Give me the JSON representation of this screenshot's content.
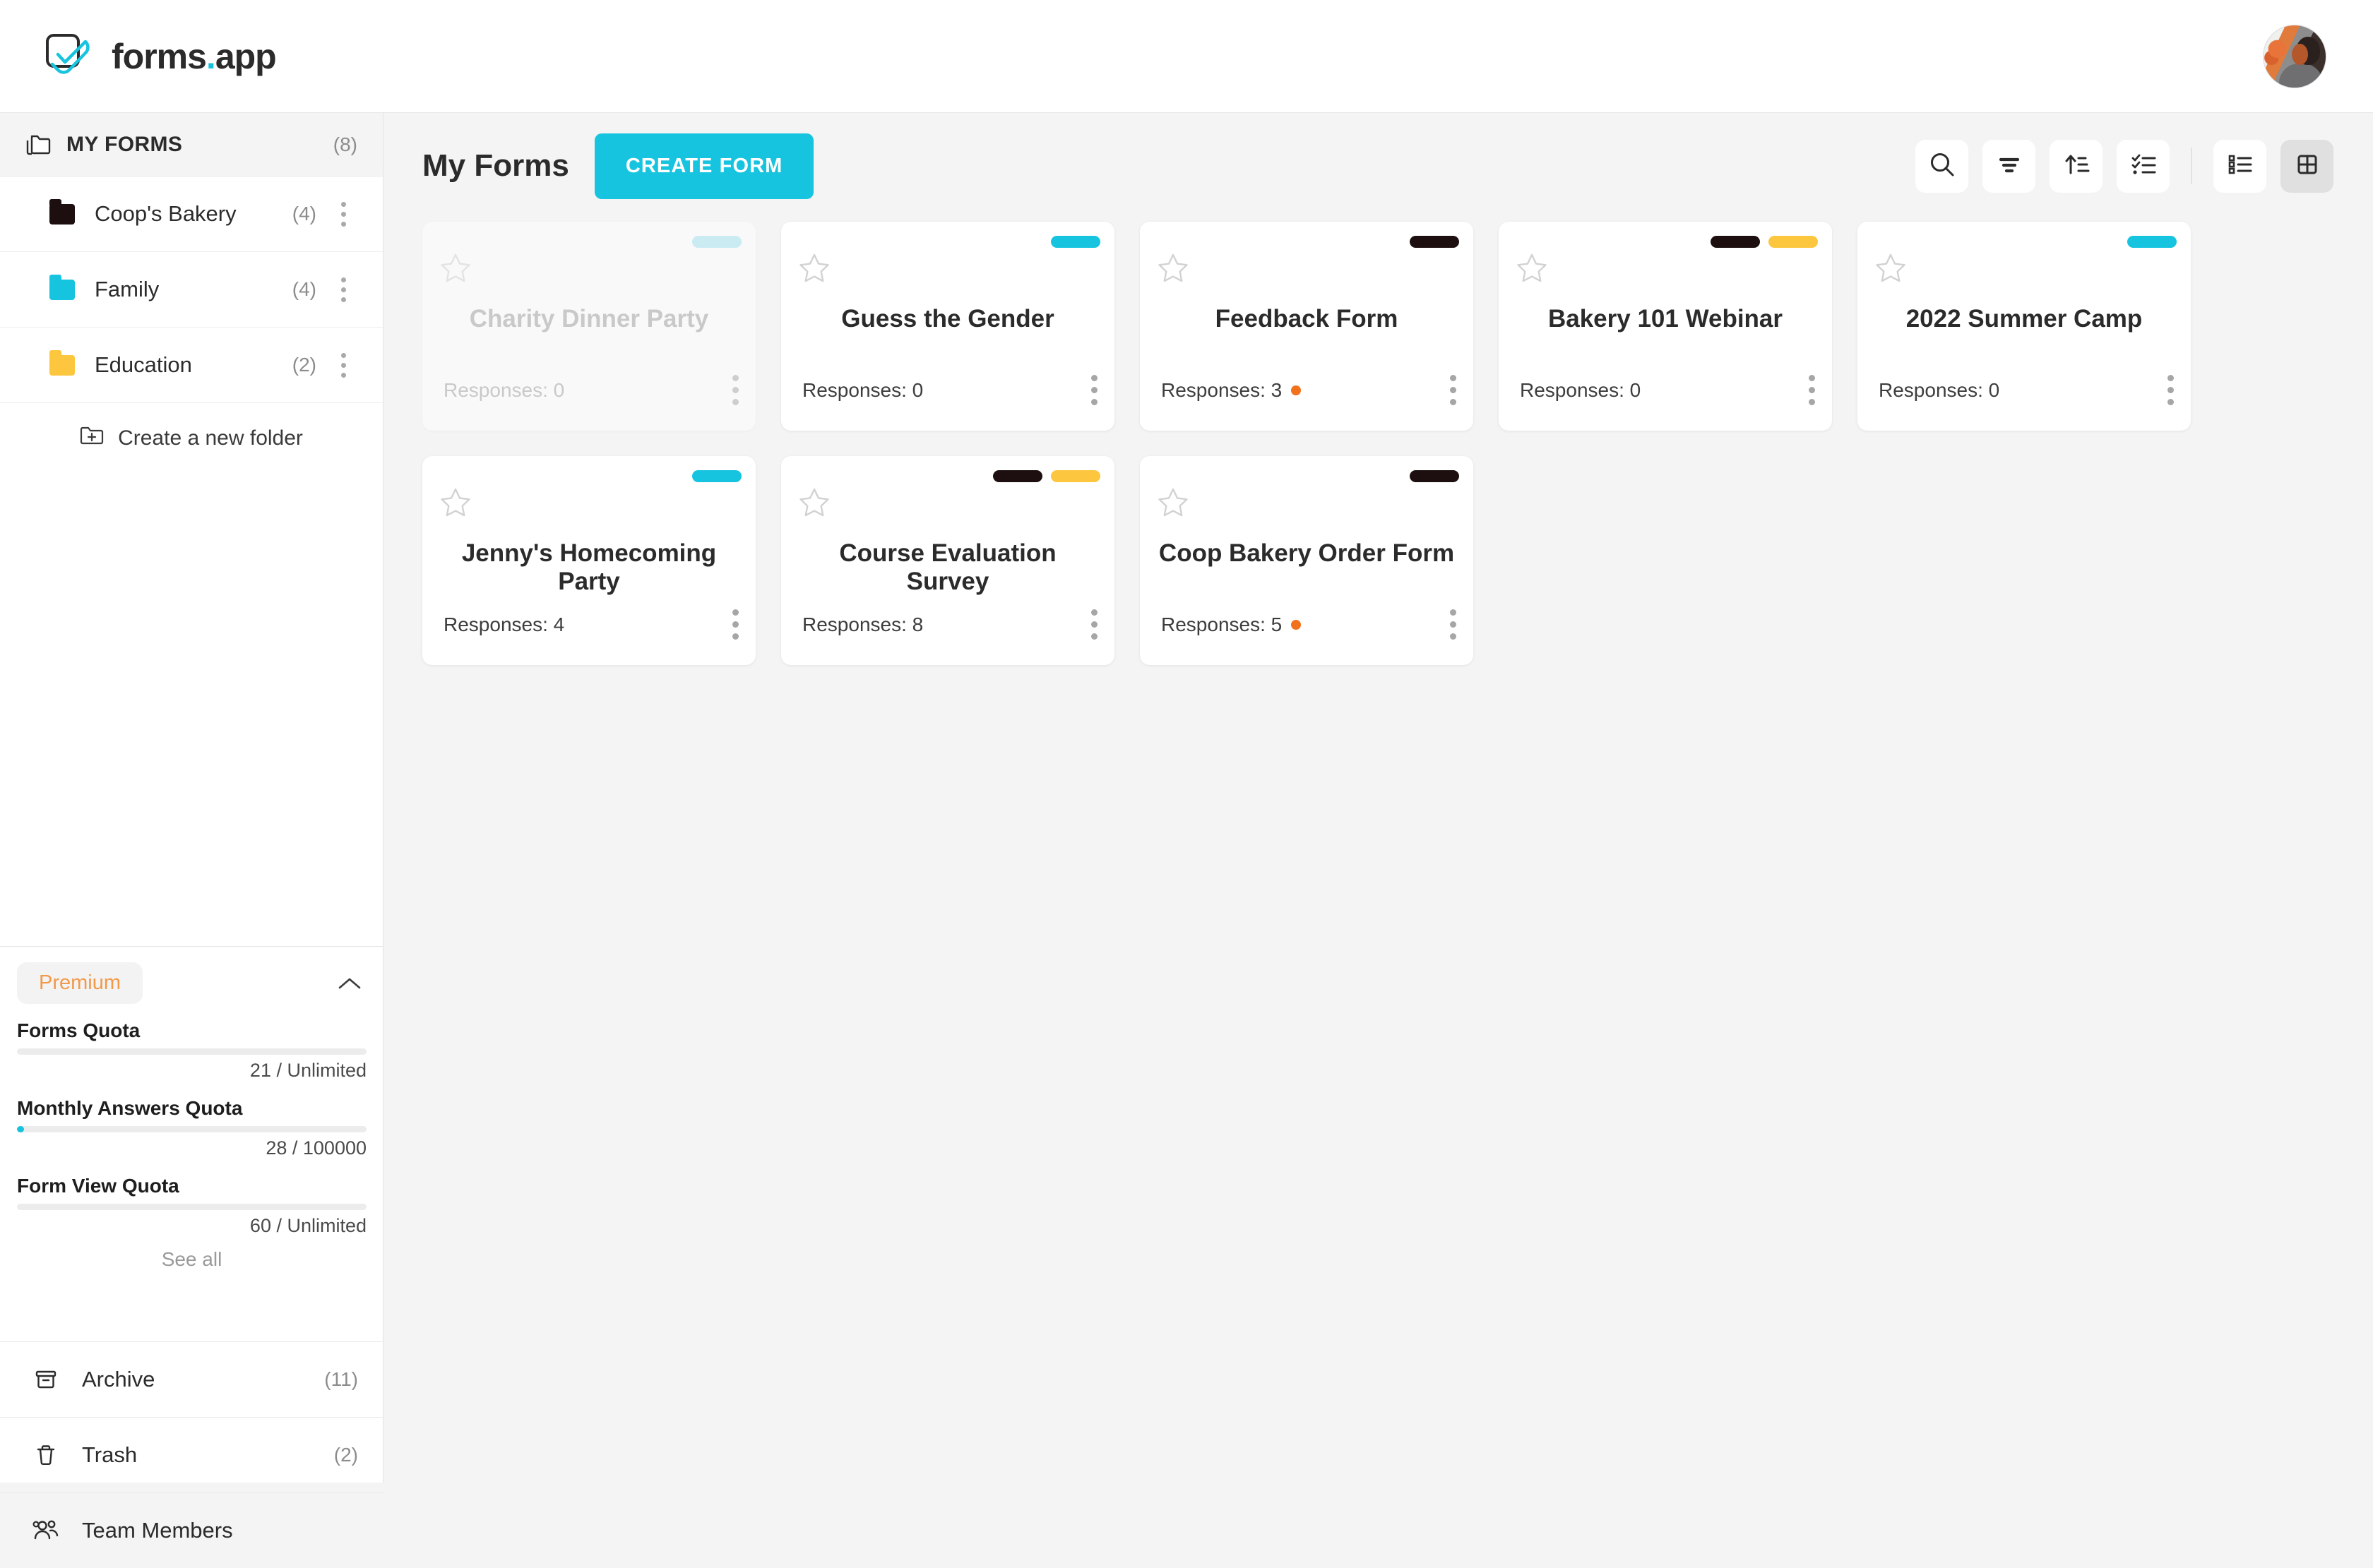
{
  "app": {
    "logo_text": "forms",
    "logo_dot": ".",
    "logo_suffix": "app",
    "accent": "#18c3de"
  },
  "sidebar": {
    "my_forms": {
      "label": "MY FORMS",
      "count": "(8)",
      "icon": "folders-icon"
    },
    "folders": [
      {
        "name": "Coop's Bakery",
        "count": "(4)",
        "color": "#1d0f10"
      },
      {
        "name": "Family",
        "count": "(4)",
        "color": "#16c4e0"
      },
      {
        "name": "Education",
        "count": "(2)",
        "color": "#fcc63f"
      }
    ],
    "create_folder": {
      "label": "Create a new folder",
      "icon": "folder-plus-icon"
    },
    "premium": {
      "badge": "Premium",
      "badge_color": "#f2994a",
      "collapse_icon": "chevron-up-icon",
      "quotas": [
        {
          "label": "Forms Quota",
          "value": "21 / Unlimited",
          "percent": 0
        },
        {
          "label": "Monthly Answers Quota",
          "value": "28 / 100000",
          "percent": 2
        },
        {
          "label": "Form View Quota",
          "value": "60 / Unlimited",
          "percent": 0
        }
      ],
      "see_all": "See all"
    },
    "bottom_nav": [
      {
        "label": "Archive",
        "count": "(11)",
        "icon": "archive-icon"
      },
      {
        "label": "Trash",
        "count": "(2)",
        "icon": "trash-icon"
      },
      {
        "label": "Team Members",
        "count": "",
        "icon": "users-icon"
      }
    ]
  },
  "main": {
    "page_title": "My Forms",
    "create_form_label": "CREATE FORM",
    "toolbar": [
      {
        "name": "search-icon",
        "active": false
      },
      {
        "name": "filter-icon",
        "active": false
      },
      {
        "name": "sort-ascending-icon",
        "active": false
      },
      {
        "name": "checklist-icon",
        "active": false
      },
      {
        "name": "list-view-icon",
        "active": false
      },
      {
        "name": "grid-view-icon",
        "active": true
      }
    ],
    "cards": [
      {
        "title": "Charity Dinner Party",
        "responses": "Responses: 0",
        "has_dot": false,
        "disabled": true,
        "tags": [
          "#9fe3f2"
        ]
      },
      {
        "title": "Guess the Gender",
        "responses": "Responses: 0",
        "has_dot": false,
        "disabled": false,
        "tags": [
          "#16c4e0"
        ]
      },
      {
        "title": "Feedback Form",
        "responses": "Responses: 3",
        "has_dot": true,
        "disabled": false,
        "tags": [
          "#1d0f10"
        ]
      },
      {
        "title": "Bakery 101 Webinar",
        "responses": "Responses: 0",
        "has_dot": false,
        "disabled": false,
        "tags": [
          "#1d0f10",
          "#fcc63f"
        ]
      },
      {
        "title": "2022 Summer Camp",
        "responses": "Responses: 0",
        "has_dot": false,
        "disabled": false,
        "tags": [
          "#16c4e0"
        ]
      },
      {
        "title": "Jenny's Homecoming Party",
        "responses": "Responses: 4",
        "has_dot": false,
        "disabled": false,
        "tags": [
          "#16c4e0"
        ]
      },
      {
        "title": "Course Evaluation Survey",
        "responses": "Responses: 8",
        "has_dot": false,
        "disabled": false,
        "tags": [
          "#1d0f10",
          "#fcc63f"
        ]
      },
      {
        "title": "Coop Bakery Order Form",
        "responses": "Responses: 5",
        "has_dot": true,
        "disabled": false,
        "tags": [
          "#1d0f10"
        ]
      }
    ],
    "status_dot_color": "#f2711c"
  }
}
